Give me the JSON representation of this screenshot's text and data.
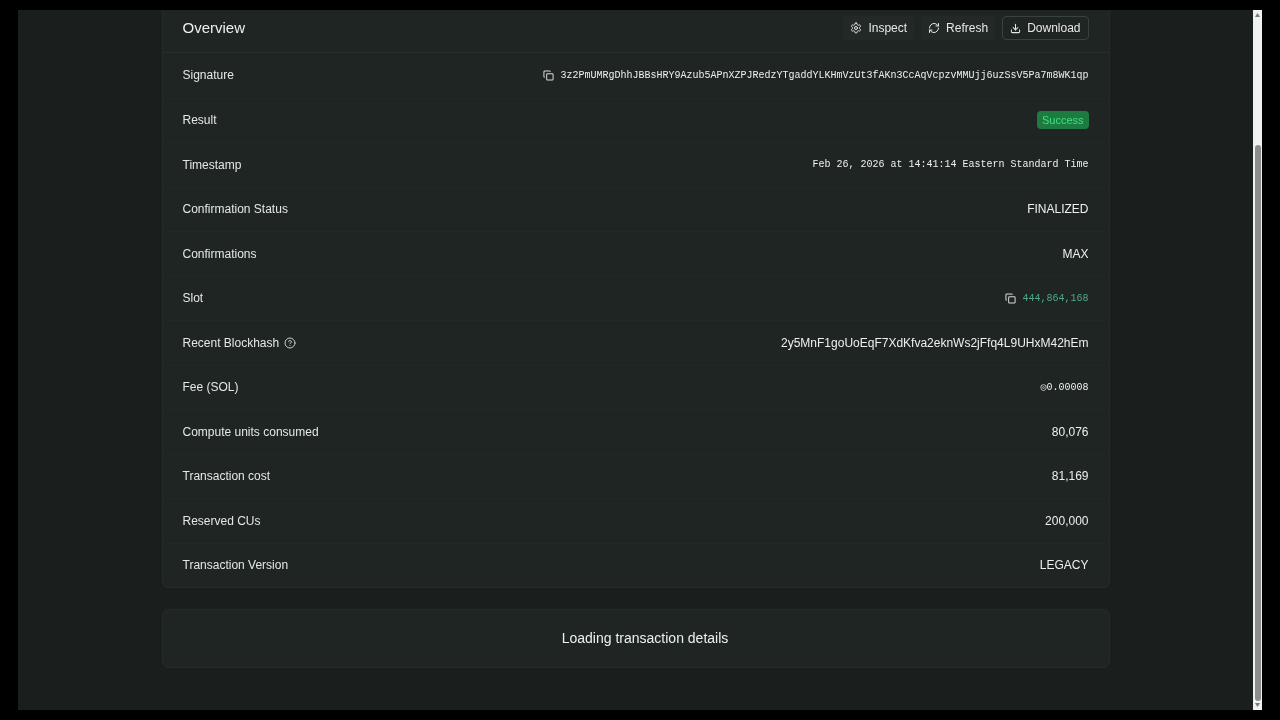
{
  "overview": {
    "title": "Overview",
    "actions": [
      {
        "label": "Inspect",
        "kind": "ghost"
      },
      {
        "label": "Refresh",
        "kind": "ghost"
      },
      {
        "label": "Download",
        "kind": "outline"
      }
    ],
    "rows": [
      {
        "label": "Signature",
        "value": "3z2PmUMRgDhhJBBsHRY9Azub5APnXZPJRedzYTgaddYLKHmVzUt3fAKn3CcAqVcpzvMMUjj6uzSsV5Pa7m8WK1qp",
        "kind": "copy-mono",
        "help": false
      },
      {
        "label": "Result",
        "value": "Success",
        "kind": "badge",
        "help": false
      },
      {
        "label": "Timestamp",
        "value": "Feb 26, 2026 at 14:41:14 Eastern Standard Time",
        "kind": "mono",
        "help": false
      },
      {
        "label": "Confirmation Status",
        "value": "FINALIZED",
        "kind": "text",
        "help": false
      },
      {
        "label": "Confirmations",
        "value": "MAX",
        "kind": "text",
        "help": false
      },
      {
        "label": "Slot",
        "value": "444,864,168",
        "kind": "copy-link",
        "help": false
      },
      {
        "label": "Recent Blockhash",
        "value": "2y5MnF1goUoEqF7XdKfva2eknWs2jFfq4L9UHxM42hEm",
        "kind": "text",
        "help": true
      },
      {
        "label": "Fee (SOL)",
        "value": "◎0.00008",
        "kind": "mono",
        "help": false
      },
      {
        "label": "Compute units consumed",
        "value": "80,076",
        "kind": "text",
        "help": false
      },
      {
        "label": "Transaction cost",
        "value": "81,169",
        "kind": "text",
        "help": false
      },
      {
        "label": "Reserved CUs",
        "value": "200,000",
        "kind": "text",
        "help": false
      },
      {
        "label": "Transaction Version",
        "value": "LEGACY",
        "kind": "text",
        "help": false
      }
    ]
  },
  "loading_panel": {
    "text": "Loading transaction details"
  }
}
